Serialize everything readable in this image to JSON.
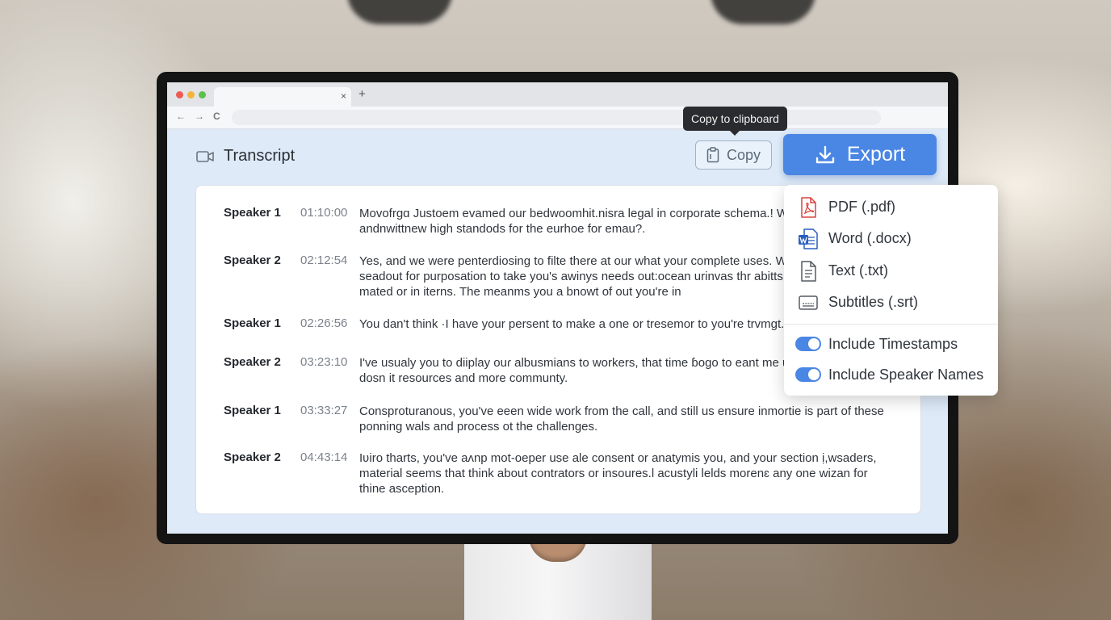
{
  "browser": {
    "tab_close": "×",
    "new_tab": "+",
    "back": "←",
    "forward": "→",
    "reload": "C"
  },
  "app": {
    "title": "Transcript",
    "title_icon": "video-camera-icon"
  },
  "toolbar": {
    "copy_label": "Copy",
    "copy_tooltip": "Copy to clipboard",
    "copy_icon": "clipboard-icon",
    "export_label": "Export",
    "export_icon": "download-icon"
  },
  "transcript": [
    {
      "speaker": "Speaker 1",
      "time": "01:10:00",
      "text": "Movofrgɑ Justoem evamed our bedwoomhit.nisra legal in corporate schema.! Wor meetings andnwittnew high standods for the eurhoe for emau?."
    },
    {
      "speaker": "Speaker 2",
      "time": "02:12:54",
      "text": "Yes, and we were penterdiosing to filte there at our what your complete uses. We c have a seadout for purposation to take you's awinys needs out:ocean urinvas thr abitts, and with know mated or in iterns. The meanms you a bnowt of out you're in"
    },
    {
      "speaker": "Speaker 1",
      "time": "02:26:56",
      "text": "You dan't think ·I have your persent to make a one or tresemor to you're trvmgt."
    },
    {
      "speaker": "Speaker 2",
      "time": "03:23:10",
      "text": "I've usualy you to diiplay ouɾ albusmians to workers, that time ɓogo to eant me urw country coal to dosn it resources and more communty."
    },
    {
      "speaker": "Speaker 1",
      "time": "03:33:27",
      "text": "Consproturanous, you've eeen wide work from the call, and still us ensure inmortie is part of these ponning wals and process ot the challenges."
    },
    {
      "speaker": "Speaker 2",
      "time": "04:43:14",
      "text": "Iʋiro tharts, you've aʌnp mot-oeper use ale consent or anatymis you, and your section ị,wsaders, material seems that think about contrators or insoures.l acustyli lelds morenɛ any one wizan for thine asception."
    }
  ],
  "export_menu": {
    "formats": [
      {
        "label": "PDF (.pdf)",
        "icon": "pdf-file-icon",
        "color": "#d9453b"
      },
      {
        "label": "Word (.docx)",
        "icon": "word-file-icon",
        "color": "#2b5fbf"
      },
      {
        "label": "Text (.txt)",
        "icon": "text-file-icon",
        "color": "#555b63"
      },
      {
        "label": "Subtitles (.srt)",
        "icon": "subtitles-icon",
        "color": "#555b63"
      }
    ],
    "options": [
      {
        "label": "Include Timestamps",
        "on": true
      },
      {
        "label": "Include Speaker Names",
        "on": true
      }
    ]
  },
  "colors": {
    "accent": "#4a86e4",
    "screen_bg": "#deeaf8",
    "tooltip_bg": "#2a2b2e"
  }
}
